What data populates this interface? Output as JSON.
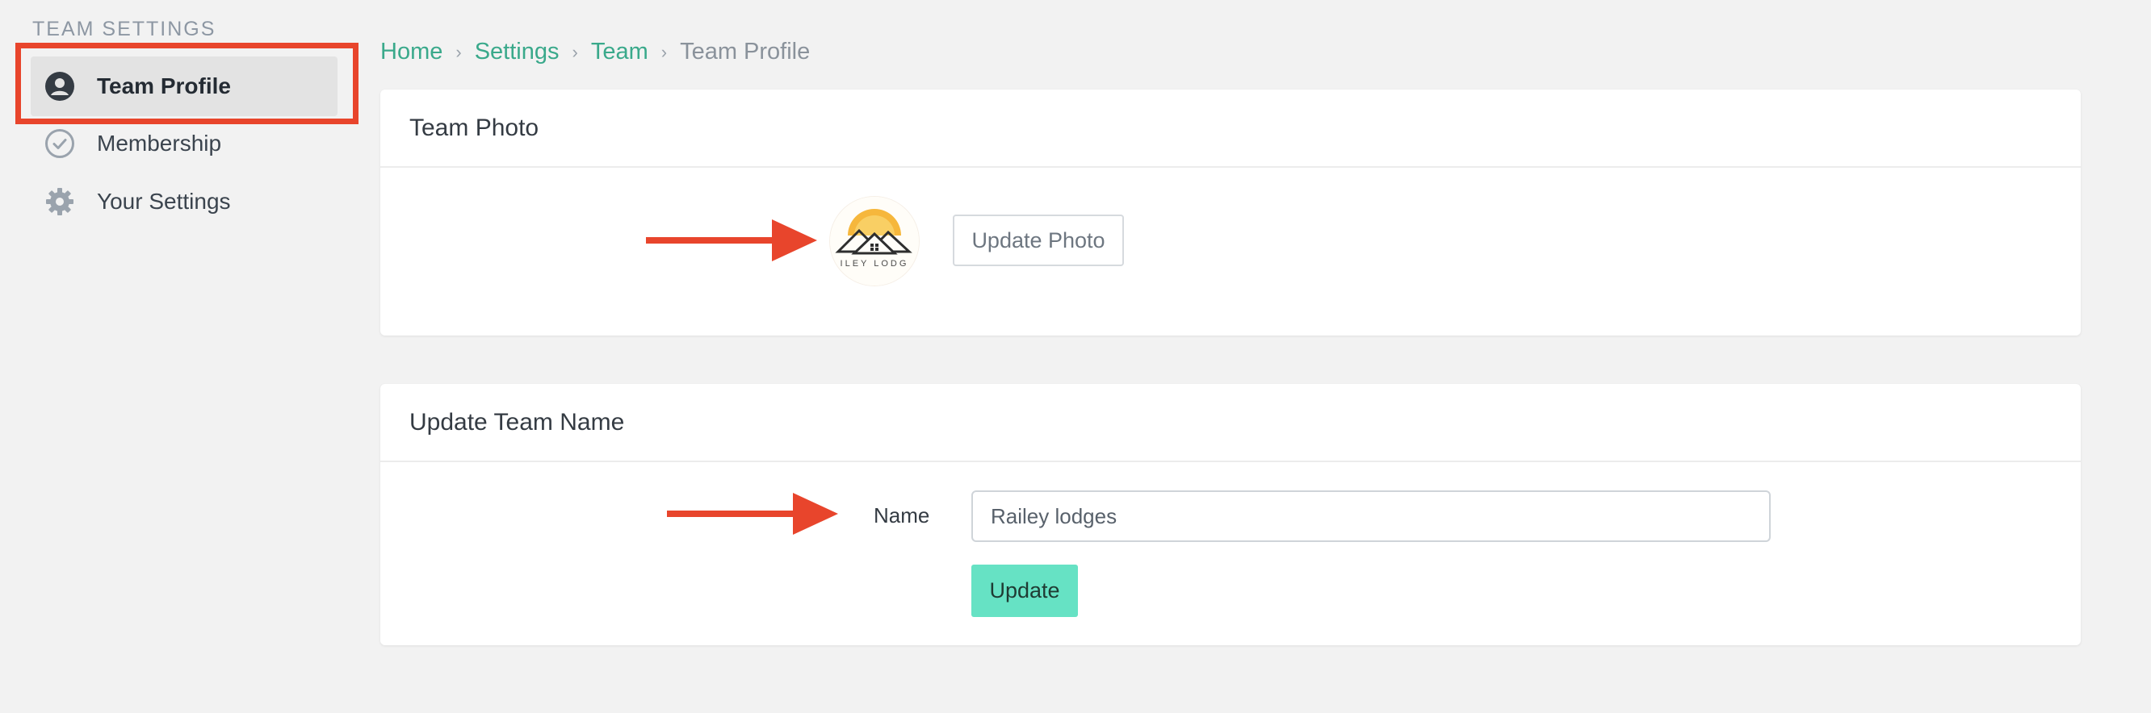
{
  "sidebar": {
    "heading": "TEAM SETTINGS",
    "items": [
      {
        "label": "Team Profile",
        "icon": "user-circle-icon",
        "active": true
      },
      {
        "label": "Membership",
        "icon": "check-circle-icon",
        "active": false
      },
      {
        "label": "Your Settings",
        "icon": "gear-icon",
        "active": false
      }
    ]
  },
  "breadcrumb": {
    "items": [
      "Home",
      "Settings",
      "Team"
    ],
    "current": "Team Profile"
  },
  "photo_card": {
    "title": "Team Photo",
    "update_button": "Update Photo",
    "logo_text": "ILEY LODG"
  },
  "name_card": {
    "title": "Update Team Name",
    "name_label": "Name",
    "name_value": "Railey lodges",
    "update_button": "Update"
  },
  "colors": {
    "accent": "#3aa98b",
    "primary_button": "#66e2c4",
    "annotation": "#e8452c",
    "background": "#f2f2f2"
  }
}
